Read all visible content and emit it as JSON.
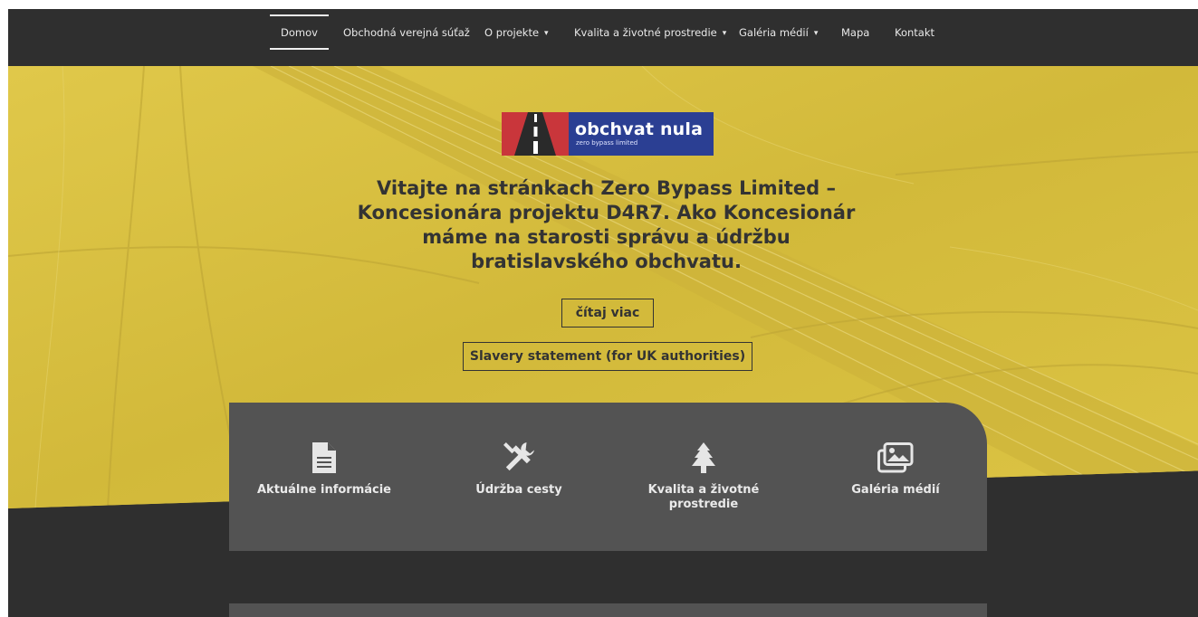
{
  "nav": {
    "items": [
      {
        "label": "Domov",
        "dropdown": false,
        "active": true
      },
      {
        "label": "Obchodná verejná súťaž",
        "dropdown": false,
        "active": false
      },
      {
        "label": "O projekte",
        "dropdown": true,
        "active": false
      },
      {
        "label": "Kvalita a životné prostredie",
        "dropdown": true,
        "active": false
      },
      {
        "label": "Galéria médií",
        "dropdown": true,
        "active": false
      },
      {
        "label": "Mapa",
        "dropdown": false,
        "active": false
      },
      {
        "label": "Kontakt",
        "dropdown": false,
        "active": false
      }
    ],
    "chevron": "⌄"
  },
  "logo": {
    "title": "obchvat nula",
    "subtitle": "zero bypass limited"
  },
  "hero": {
    "text": "Vitajte na stránkach Zero Bypass Limited – Koncesionára projektu D4R7. Ako Koncesionár máme na starosti správu a údržbu bratislavského obchvatu.",
    "read_more": "čítaj viac",
    "slavery": "Slavery statement (for UK authorities)"
  },
  "services": [
    {
      "label": "Aktuálne informácie",
      "icon": "document-icon"
    },
    {
      "label": "Údržba cesty",
      "icon": "tools-icon"
    },
    {
      "label": "Kvalita a životné prostredie",
      "icon": "tree-icon"
    },
    {
      "label": "Galéria médií",
      "icon": "gallery-icon"
    }
  ],
  "colors": {
    "dark_bg": "#2f2f2f",
    "hero_yellow": "#d7bf3f",
    "card_gray": "#535353",
    "logo_blue": "#2b3f93",
    "logo_red": "#c9363b"
  }
}
